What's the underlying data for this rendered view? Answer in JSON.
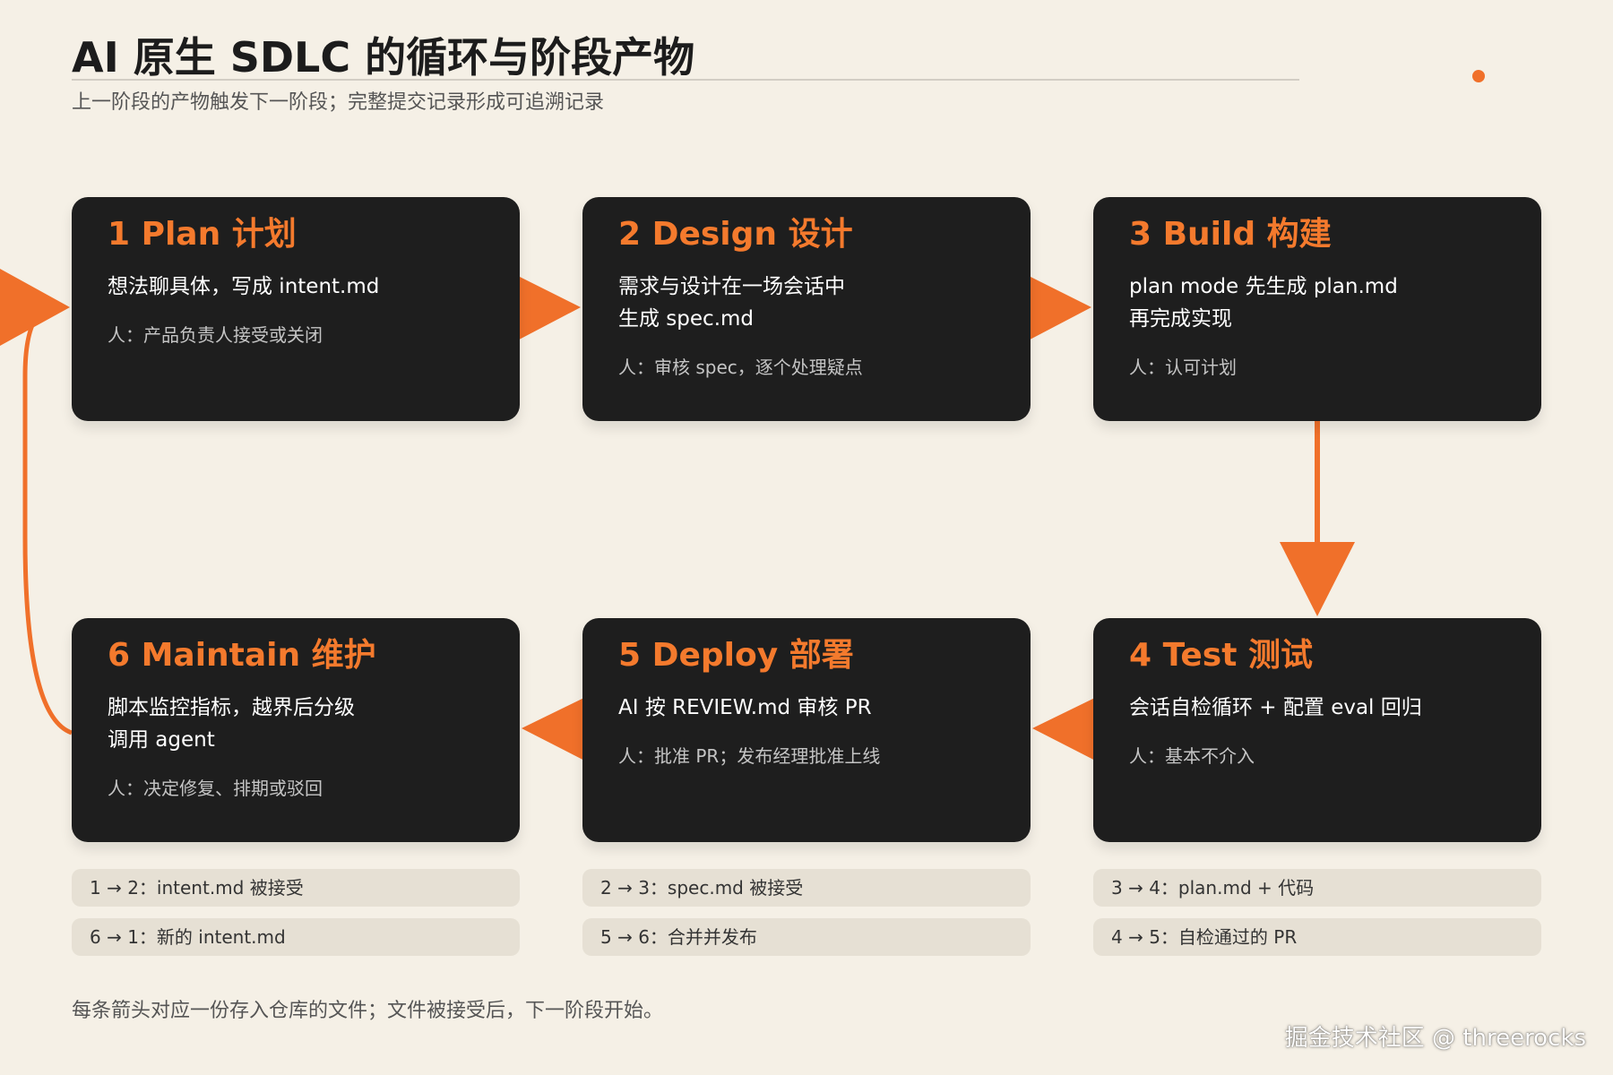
{
  "header": {
    "title": "AI 原生 SDLC 的循环与阶段产物",
    "subtitle": "上一阶段的产物触发下一阶段；完整提交记录形成可追溯记录"
  },
  "cards": [
    {
      "title": "1 Plan 计划",
      "desc": "想法聊具体，写成 intent.md",
      "human": "人：产品负责人接受或关闭"
    },
    {
      "title": "2 Design 设计",
      "desc": "需求与设计在一场会话中\n生成 spec.md",
      "human": "人：审核 spec，逐个处理疑点"
    },
    {
      "title": "3 Build 构建",
      "desc": "plan mode 先生成 plan.md\n再完成实现",
      "human": "人：认可计划"
    },
    {
      "title": "4 Test 测试",
      "desc": "会话自检循环 + 配置 eval 回归",
      "human": "人：基本不介入"
    },
    {
      "title": "5 Deploy 部署",
      "desc": "AI 按 REVIEW.md 审核 PR",
      "human": "人：批准 PR；发布经理批准上线"
    },
    {
      "title": "6 Maintain 维护",
      "desc": "脚本监控指标，越界后分级\n调用 agent",
      "human": "人：决定修复、排期或驳回"
    }
  ],
  "transitions": [
    "1 → 2：intent.md 被接受",
    "2 → 3：spec.md 被接受",
    "3 → 4：plan.md + 代码",
    "6 → 1：新的 intent.md",
    "5 → 6：合并并发布",
    "4 → 5：自检通过的 PR"
  ],
  "footer": {
    "note": "每条箭头对应一份存入仓库的文件；文件被接受后，下一阶段开始。",
    "watermark": "掘金技术社区 @ threerocks"
  },
  "colors": {
    "accent": "#f0702a",
    "card_bg": "#1e1e1e",
    "page_bg": "#f5f0e6",
    "pill_bg": "#e6e0d4"
  }
}
